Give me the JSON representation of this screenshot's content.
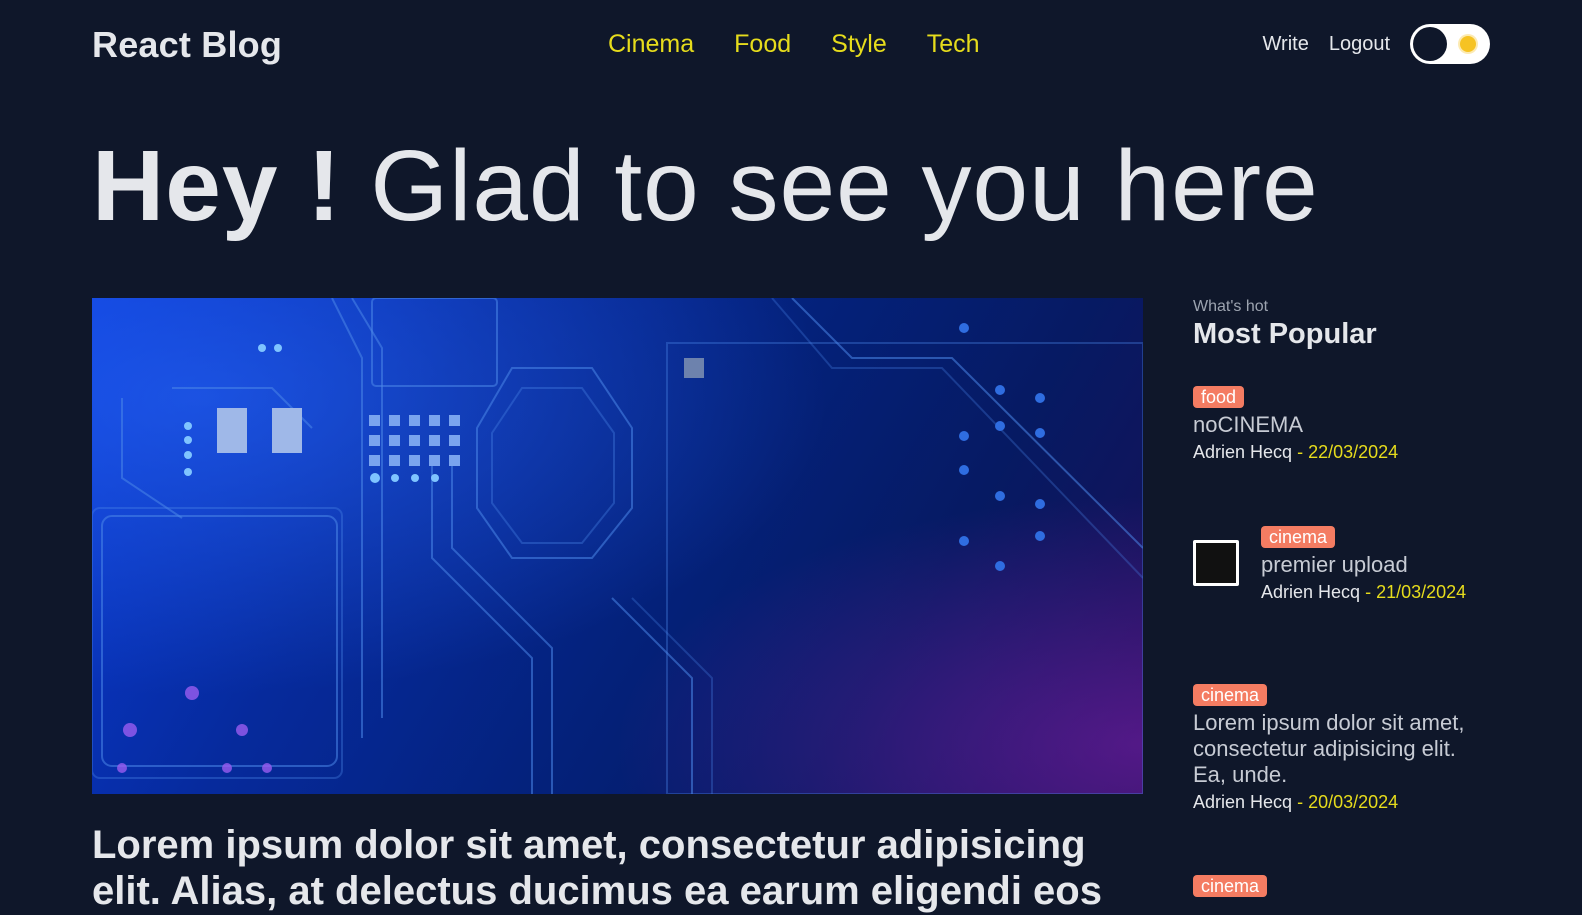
{
  "nav": {
    "brand": "React Blog",
    "links": [
      "Cinema",
      "Food",
      "Style",
      "Tech"
    ],
    "write": "Write",
    "logout": "Logout"
  },
  "hero": {
    "bold": "Hey !",
    "light": "Glad to see you here"
  },
  "featured": {
    "title": "Lorem ipsum dolor sit amet, consectetur adipisicing elit. Alias, at delectus ducimus ea earum eligendi eos"
  },
  "sidebar": {
    "subtitle": "What's hot",
    "title": "Most Popular",
    "items": [
      {
        "tag": "food",
        "title": "noCINEMA",
        "author": "Adrien Hecq",
        "date": "- 22/03/2024"
      },
      {
        "tag": "cinema",
        "title": "premier upload",
        "author": "Adrien Hecq",
        "date": "- 21/03/2024"
      },
      {
        "tag": "cinema",
        "title": "Lorem ipsum dolor sit amet, consectetur adipisicing elit. Ea, unde.",
        "author": "Adrien Hecq",
        "date": "- 20/03/2024"
      },
      {
        "tag": "cinema"
      }
    ]
  },
  "colors": {
    "background": "#0f172a",
    "accent": "#e6dc1c",
    "badge": "#f47c62"
  },
  "icons": {
    "theme_toggle": "sun-icon"
  }
}
